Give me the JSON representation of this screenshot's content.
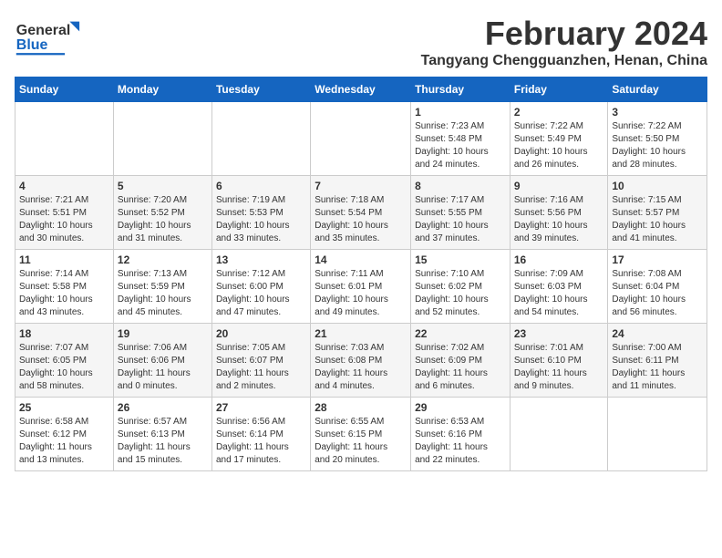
{
  "header": {
    "logo_general": "General",
    "logo_blue": "Blue",
    "title": "February 2024",
    "subtitle": "Tangyang Chengguanzhen, Henan, China"
  },
  "columns": [
    "Sunday",
    "Monday",
    "Tuesday",
    "Wednesday",
    "Thursday",
    "Friday",
    "Saturday"
  ],
  "weeks": [
    [
      {
        "day": "",
        "info": ""
      },
      {
        "day": "",
        "info": ""
      },
      {
        "day": "",
        "info": ""
      },
      {
        "day": "",
        "info": ""
      },
      {
        "day": "1",
        "info": "Sunrise: 7:23 AM\nSunset: 5:48 PM\nDaylight: 10 hours\nand 24 minutes."
      },
      {
        "day": "2",
        "info": "Sunrise: 7:22 AM\nSunset: 5:49 PM\nDaylight: 10 hours\nand 26 minutes."
      },
      {
        "day": "3",
        "info": "Sunrise: 7:22 AM\nSunset: 5:50 PM\nDaylight: 10 hours\nand 28 minutes."
      }
    ],
    [
      {
        "day": "4",
        "info": "Sunrise: 7:21 AM\nSunset: 5:51 PM\nDaylight: 10 hours\nand 30 minutes."
      },
      {
        "day": "5",
        "info": "Sunrise: 7:20 AM\nSunset: 5:52 PM\nDaylight: 10 hours\nand 31 minutes."
      },
      {
        "day": "6",
        "info": "Sunrise: 7:19 AM\nSunset: 5:53 PM\nDaylight: 10 hours\nand 33 minutes."
      },
      {
        "day": "7",
        "info": "Sunrise: 7:18 AM\nSunset: 5:54 PM\nDaylight: 10 hours\nand 35 minutes."
      },
      {
        "day": "8",
        "info": "Sunrise: 7:17 AM\nSunset: 5:55 PM\nDaylight: 10 hours\nand 37 minutes."
      },
      {
        "day": "9",
        "info": "Sunrise: 7:16 AM\nSunset: 5:56 PM\nDaylight: 10 hours\nand 39 minutes."
      },
      {
        "day": "10",
        "info": "Sunrise: 7:15 AM\nSunset: 5:57 PM\nDaylight: 10 hours\nand 41 minutes."
      }
    ],
    [
      {
        "day": "11",
        "info": "Sunrise: 7:14 AM\nSunset: 5:58 PM\nDaylight: 10 hours\nand 43 minutes."
      },
      {
        "day": "12",
        "info": "Sunrise: 7:13 AM\nSunset: 5:59 PM\nDaylight: 10 hours\nand 45 minutes."
      },
      {
        "day": "13",
        "info": "Sunrise: 7:12 AM\nSunset: 6:00 PM\nDaylight: 10 hours\nand 47 minutes."
      },
      {
        "day": "14",
        "info": "Sunrise: 7:11 AM\nSunset: 6:01 PM\nDaylight: 10 hours\nand 49 minutes."
      },
      {
        "day": "15",
        "info": "Sunrise: 7:10 AM\nSunset: 6:02 PM\nDaylight: 10 hours\nand 52 minutes."
      },
      {
        "day": "16",
        "info": "Sunrise: 7:09 AM\nSunset: 6:03 PM\nDaylight: 10 hours\nand 54 minutes."
      },
      {
        "day": "17",
        "info": "Sunrise: 7:08 AM\nSunset: 6:04 PM\nDaylight: 10 hours\nand 56 minutes."
      }
    ],
    [
      {
        "day": "18",
        "info": "Sunrise: 7:07 AM\nSunset: 6:05 PM\nDaylight: 10 hours\nand 58 minutes."
      },
      {
        "day": "19",
        "info": "Sunrise: 7:06 AM\nSunset: 6:06 PM\nDaylight: 11 hours\nand 0 minutes."
      },
      {
        "day": "20",
        "info": "Sunrise: 7:05 AM\nSunset: 6:07 PM\nDaylight: 11 hours\nand 2 minutes."
      },
      {
        "day": "21",
        "info": "Sunrise: 7:03 AM\nSunset: 6:08 PM\nDaylight: 11 hours\nand 4 minutes."
      },
      {
        "day": "22",
        "info": "Sunrise: 7:02 AM\nSunset: 6:09 PM\nDaylight: 11 hours\nand 6 minutes."
      },
      {
        "day": "23",
        "info": "Sunrise: 7:01 AM\nSunset: 6:10 PM\nDaylight: 11 hours\nand 9 minutes."
      },
      {
        "day": "24",
        "info": "Sunrise: 7:00 AM\nSunset: 6:11 PM\nDaylight: 11 hours\nand 11 minutes."
      }
    ],
    [
      {
        "day": "25",
        "info": "Sunrise: 6:58 AM\nSunset: 6:12 PM\nDaylight: 11 hours\nand 13 minutes."
      },
      {
        "day": "26",
        "info": "Sunrise: 6:57 AM\nSunset: 6:13 PM\nDaylight: 11 hours\nand 15 minutes."
      },
      {
        "day": "27",
        "info": "Sunrise: 6:56 AM\nSunset: 6:14 PM\nDaylight: 11 hours\nand 17 minutes."
      },
      {
        "day": "28",
        "info": "Sunrise: 6:55 AM\nSunset: 6:15 PM\nDaylight: 11 hours\nand 20 minutes."
      },
      {
        "day": "29",
        "info": "Sunrise: 6:53 AM\nSunset: 6:16 PM\nDaylight: 11 hours\nand 22 minutes."
      },
      {
        "day": "",
        "info": ""
      },
      {
        "day": "",
        "info": ""
      }
    ]
  ]
}
